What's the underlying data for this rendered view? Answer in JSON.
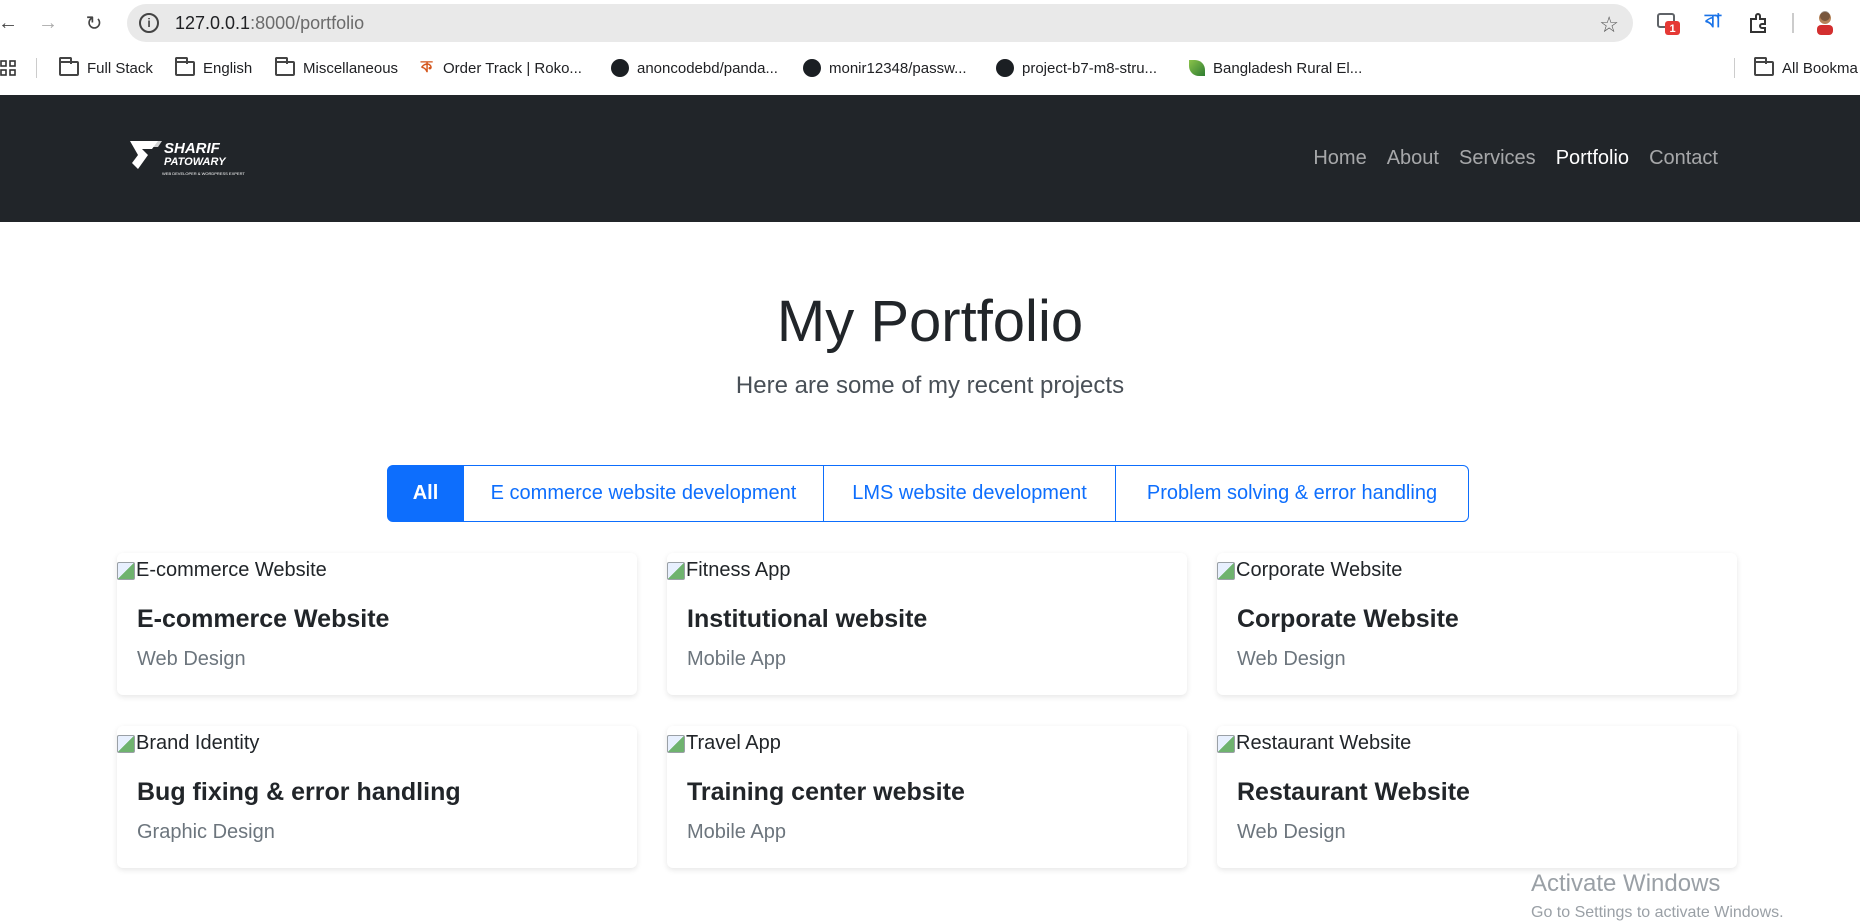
{
  "browser": {
    "url_host": "127.0.0.1",
    "url_path": ":8000/portfolio",
    "extension_badge": "1",
    "bangla_ext": "বা",
    "bookmarks": [
      {
        "label": "Full Stack",
        "icon": "folder-icon"
      },
      {
        "label": "English",
        "icon": "folder-icon"
      },
      {
        "label": "Miscellaneous",
        "icon": "folder-icon"
      },
      {
        "label": "Order Track | Roko...",
        "icon": "order-icon"
      },
      {
        "label": "anoncodebd/panda...",
        "icon": "github-icon"
      },
      {
        "label": "monir12348/passw...",
        "icon": "github-icon"
      },
      {
        "label": "project-b7-m8-stru...",
        "icon": "github-icon"
      },
      {
        "label": "Bangladesh Rural El...",
        "icon": "leaf-icon"
      },
      {
        "label": "All Bookma",
        "icon": "folder-icon"
      }
    ]
  },
  "site": {
    "logo_line1": "SHARIF",
    "logo_line2": "PATOWARY",
    "logo_tagline": "WEB DEVELOPER & WORDPRESS EXPERT",
    "nav": [
      "Home",
      "About",
      "Services",
      "Portfolio",
      "Contact"
    ],
    "active_nav": "Portfolio"
  },
  "hero": {
    "title": "My Portfolio",
    "subtitle": "Here are some of my recent projects"
  },
  "filters": [
    "All",
    "E commerce website development",
    "LMS website development",
    "Problem solving & error handling"
  ],
  "projects": [
    {
      "alt": "E-commerce Website",
      "title": "E-commerce Website",
      "category": "Web Design"
    },
    {
      "alt": "Fitness App",
      "title": "Institutional website",
      "category": "Mobile App"
    },
    {
      "alt": "Corporate Website",
      "title": "Corporate Website",
      "category": "Web Design"
    },
    {
      "alt": "Brand Identity",
      "title": "Bug fixing & error handling",
      "category": "Graphic Design"
    },
    {
      "alt": "Travel App",
      "title": "Training center website",
      "category": "Mobile App"
    },
    {
      "alt": "Restaurant Website",
      "title": "Restaurant Website",
      "category": "Web Design"
    }
  ],
  "watermark": {
    "line1": "Activate Windows",
    "line2": "Go to Settings to activate Windows."
  }
}
